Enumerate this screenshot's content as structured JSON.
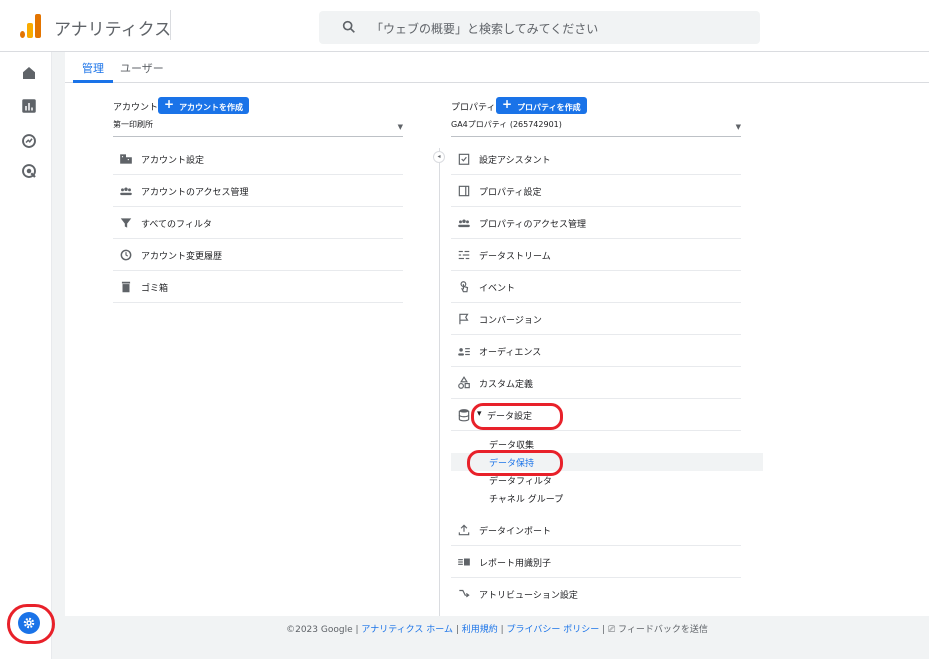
{
  "app": {
    "title": "アナリティクス"
  },
  "search": {
    "placeholder": "「ウェブの概要」と検索してみてください"
  },
  "tabs": [
    {
      "label": "管理",
      "active": true
    },
    {
      "label": "ユーザー",
      "active": false
    }
  ],
  "account": {
    "label": "アカウント",
    "create_label": "アカウントを作成",
    "selected": "第一印刷所",
    "items": [
      {
        "label": "アカウント設定",
        "icon": "building-icon"
      },
      {
        "label": "アカウントのアクセス管理",
        "icon": "people-icon"
      },
      {
        "label": "すべてのフィルタ",
        "icon": "filter-icon"
      },
      {
        "label": "アカウント変更履歴",
        "icon": "history-icon"
      },
      {
        "label": "ゴミ箱",
        "icon": "trash-icon"
      }
    ]
  },
  "property": {
    "label": "プロパティ",
    "create_label": "プロパティを作成",
    "selected": "GA4プロパティ (265742901)",
    "items": [
      {
        "label": "設定アシスタント",
        "icon": "checklist-icon"
      },
      {
        "label": "プロパティ設定",
        "icon": "property-icon"
      },
      {
        "label": "プロパティのアクセス管理",
        "icon": "people-icon"
      },
      {
        "label": "データストリーム",
        "icon": "stream-icon"
      },
      {
        "label": "イベント",
        "icon": "touch-icon"
      },
      {
        "label": "コンバージョン",
        "icon": "flag-icon"
      },
      {
        "label": "オーディエンス",
        "icon": "audience-icon"
      },
      {
        "label": "カスタム定義",
        "icon": "shapes-icon"
      },
      {
        "label": "データ設定",
        "icon": "database-icon"
      }
    ],
    "data_settings_sub": [
      "データ収集",
      "データ保持",
      "データフィルタ",
      "チャネル グループ"
    ],
    "items_after": [
      {
        "label": "データインポート",
        "icon": "upload-icon"
      },
      {
        "label": "レポート用識別子",
        "icon": "identity-icon"
      },
      {
        "label": "アトリビューション設定",
        "icon": "attribution-icon"
      }
    ]
  },
  "footer": {
    "copyright": "©2023 Google | ",
    "link1": "アナリティクス ホーム",
    "link2": "利用規約",
    "link3": "プライバシー ポリシー",
    "feedback": "フィードバックを送信"
  },
  "colors": {
    "accent": "#1a73e8",
    "highlight_ring": "#e8212a",
    "logo_orange": "#f9ab00",
    "logo_dark": "#e37400"
  }
}
